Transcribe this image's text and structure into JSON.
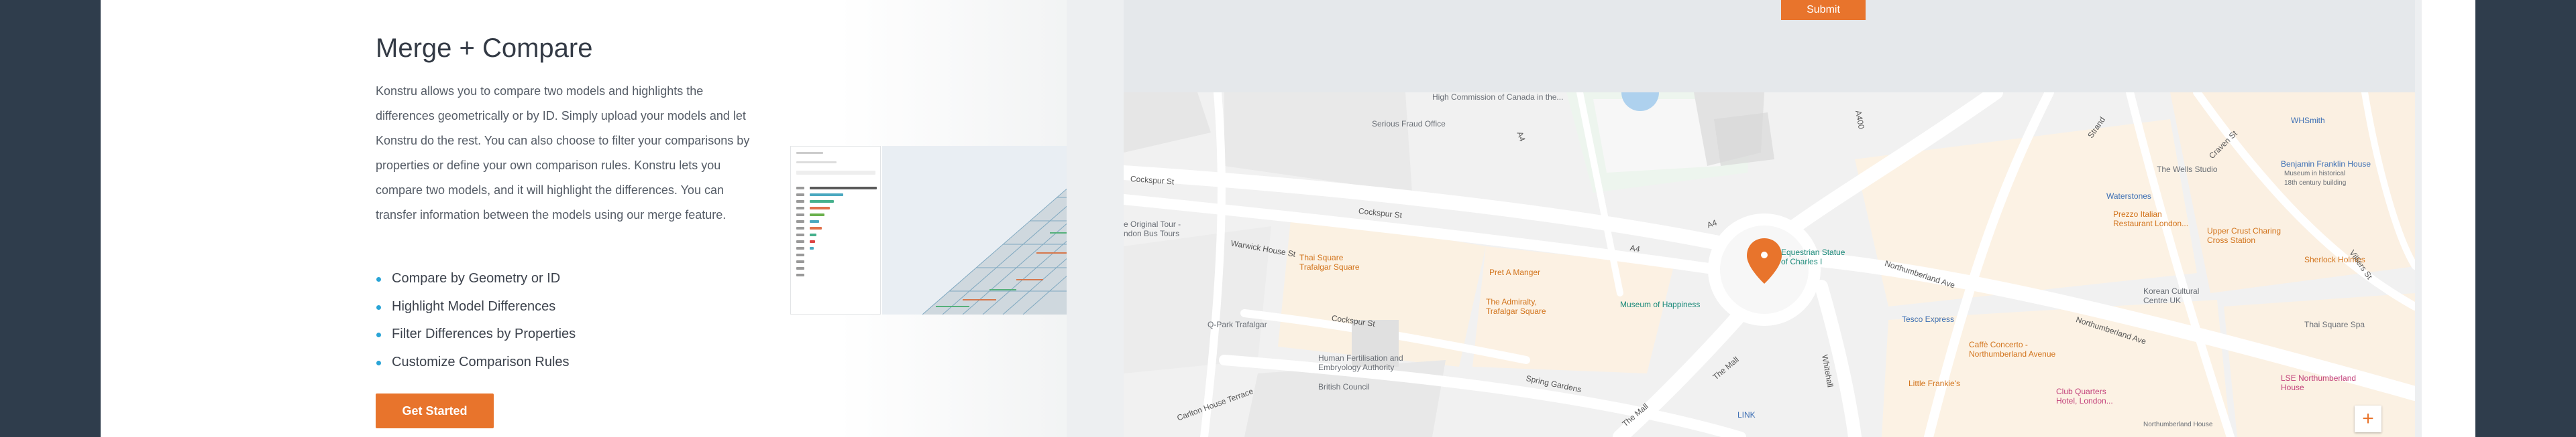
{
  "feature": {
    "title": "Merge + Compare",
    "description": "Konstru allows you to compare two models and highlights the differences geometrically or by ID. Simply upload your models and let Konstru do the rest. You can also choose to filter your comparisons by properties or define your own comparison rules. Konstru lets you compare two models, and it will highlight the differences. You can transfer information between the models using our merge feature.",
    "bullets": [
      "Compare by Geometry or ID",
      "Highlight Model Differences",
      "Filter Differences by Properties",
      "Customize Comparison Rules"
    ],
    "cta_label": "Get Started"
  },
  "contact": {
    "submit_label": "Submit"
  },
  "map": {
    "labels": {
      "high_commission": "High Commission of Canada in the...",
      "serious_fraud": "Serious Fraud Office",
      "cockspur_st_1": "Cockspur St",
      "cockspur_st_2": "Cockspur St",
      "cockspur_st_3": "Cockspur St",
      "original_tour": "e Original Tour -\nndon Bus Tours",
      "warwick_house": "Warwick House St",
      "thai_square_trafalgar": "Thai Square\nTrafalgar Square",
      "pret": "Pret A Manger",
      "admiralty": "The Admiralty,\nTrafalgar Square",
      "museum_happiness": "Museum of Happiness",
      "qpark": "Q-Park Trafalgar",
      "hfea": "Human Fertilisation and\nEmbryology Authority",
      "british_council": "British Council",
      "spring_gardens": "Spring Gardens",
      "the_mall_1": "The Mall",
      "the_mall_2": "The Mall",
      "carlton_house": "Carlton House Terrace",
      "a4_1": "A4",
      "a4_2": "A4",
      "a4_3": "A4",
      "a400": "A400",
      "equestrian": "Equestrian Statue\nof Charles I",
      "strand": "Strand",
      "wells_studio": "The Wells Studio",
      "waterstones": "Waterstones",
      "prezzo": "Prezzo Italian\nRestaurant London...",
      "northumberland_ave_1": "Northumberland Ave",
      "northumberland_ave_2": "Northumberland Ave",
      "korean_cultural": "Korean Cultural\nCentre UK",
      "tesco": "Tesco Express",
      "caffe_concerto": "Caffè Concerto -\nNorthumberland Avenue",
      "little_frankies": "Little Frankie's",
      "club_quarters": "Club Quarters\nHotel, London...",
      "link": "LINK",
      "whitehall": "Whitehall",
      "northumberland_house": "Northumberland House",
      "franklin": "Benjamin Franklin House",
      "franklin_sub": "Museum in historical\n18th century building",
      "whsmith": "WHSmith",
      "upper_crust": "Upper Crust Charing\nCross Station",
      "sherlock": "Sherlock Holmes",
      "thai_spa": "Thai Square Spa",
      "lse": "LSE Northumberland\nHouse",
      "craven_st": "Craven St",
      "villiers_st": "Villiers St"
    }
  },
  "colors": {
    "accent": "#e8742c",
    "bullet": "#2aa4d6",
    "background": "#2f3d4c"
  },
  "icons": {
    "map_pin": "map-pin-icon",
    "zoom_in": "plus-icon"
  }
}
